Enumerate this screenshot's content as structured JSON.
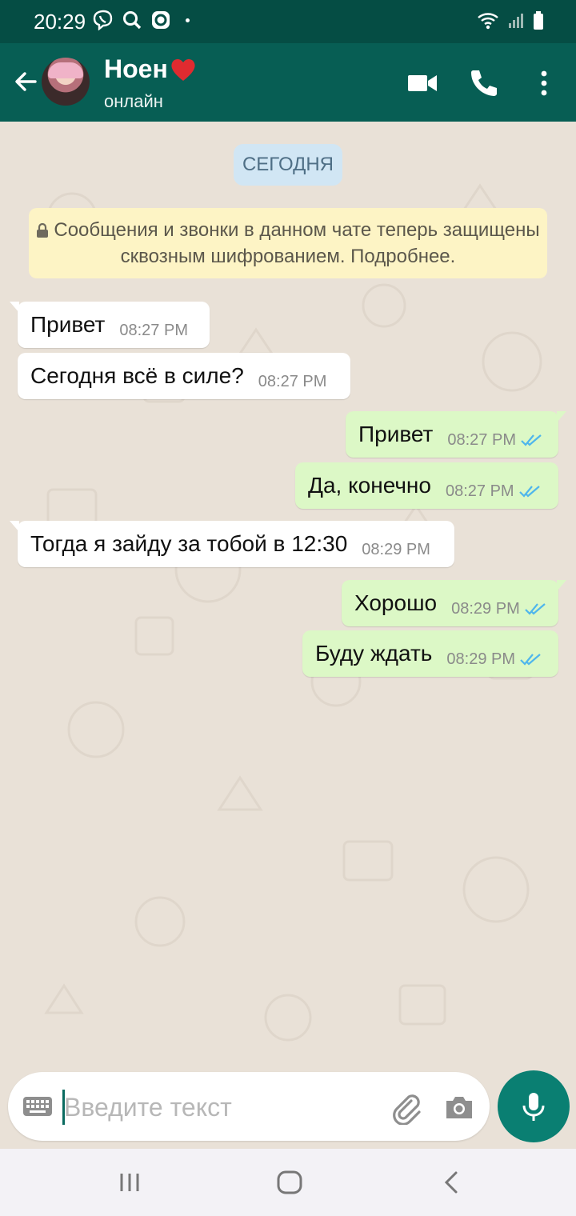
{
  "status_bar": {
    "time": "20:29",
    "icons": [
      "viber-icon",
      "search-icon",
      "app-icon",
      "dot-icon"
    ],
    "right_icons": [
      "wifi-icon",
      "signal-icon",
      "battery-icon"
    ]
  },
  "header": {
    "contact_name": "Ноен",
    "presence": "онлайн",
    "actions": [
      "video-call-icon",
      "voice-call-icon",
      "more-icon"
    ]
  },
  "chat": {
    "date_chip": "СЕГОДНЯ",
    "encryption_notice": "Сообщения и звонки в данном чате теперь защищены сквозным шифрованием. Подробнее.",
    "messages": [
      {
        "direction": "in",
        "text": "Привет",
        "time": "08:27 PM"
      },
      {
        "direction": "in",
        "text": "Сегодня всё в силе?",
        "time": "08:27 PM"
      },
      {
        "direction": "out",
        "text": "Привет",
        "time": "08:27 PM",
        "status": "read"
      },
      {
        "direction": "out",
        "text": "Да, конечно",
        "time": "08:27 PM",
        "status": "read"
      },
      {
        "direction": "in",
        "text": "Тогда я зайду за тобой в 12:30",
        "time": "08:29 PM"
      },
      {
        "direction": "out",
        "text": "Хорошо",
        "time": "08:29 PM",
        "status": "read"
      },
      {
        "direction": "out",
        "text": "Буду ждать",
        "time": "08:29 PM",
        "status": "read"
      }
    ]
  },
  "composer": {
    "placeholder": "Введите текст",
    "icons": [
      "keyboard-icon",
      "attach-icon",
      "camera-icon",
      "mic-icon"
    ]
  },
  "nav": {
    "icons": [
      "recent-apps-icon",
      "home-icon",
      "back-icon"
    ]
  },
  "colors": {
    "header": "#075e54",
    "status_bar": "#054d44",
    "outgoing_bubble": "#dcf8c6",
    "incoming_bubble": "#ffffff",
    "read_ticks": "#4fb6ec",
    "mic_button": "#0a7f72"
  }
}
